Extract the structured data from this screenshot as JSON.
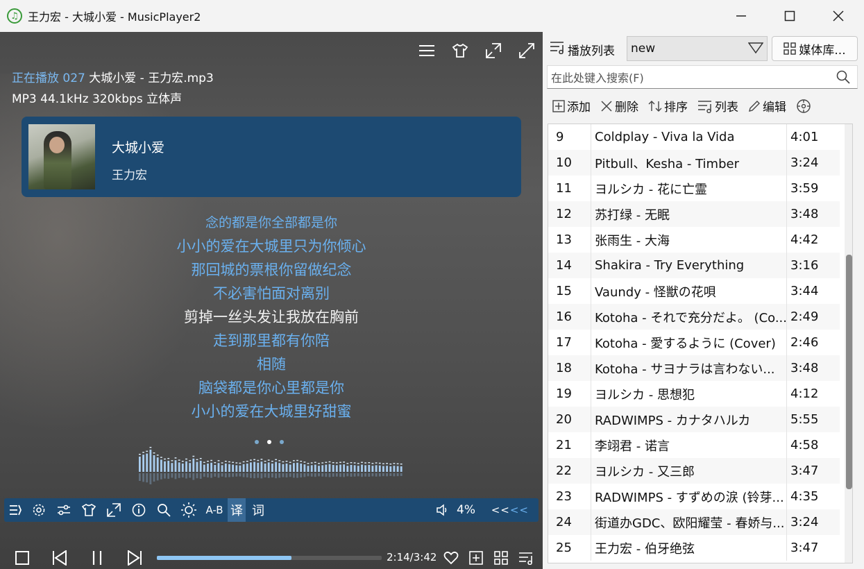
{
  "window": {
    "title": "王力宏 - 大城小爱 - MusicPlayer2",
    "minimize_icon": "minimize-icon",
    "maximize_icon": "maximize-icon",
    "close_icon": "close-icon"
  },
  "now_playing": {
    "prefix": "正在播放",
    "index": "027",
    "file": "大城小爱 - 王力宏.mp3",
    "format": "MP3 44.1kHz 320kbps 立体声",
    "song": "大城小爱",
    "artist": "王力宏"
  },
  "lyrics": [
    "念的都是你全部都是你",
    "小小的爱在大城里只为你倾心",
    "那回城的票根你留做纪念",
    "不必害怕面对离别",
    "剪掉一丝头发让我放在胸前",
    "走到那里都有你陪",
    "相随",
    "脑袋都是你心里都是你",
    "小小的爱在大城里好甜蜜"
  ],
  "current_lyric_index": 4,
  "controls": {
    "ab_label": "A-B",
    "translate_label": "译",
    "lyric_label": "词",
    "volume": "4%",
    "arrows_white": "<<",
    "arrows_blue": "<<"
  },
  "playback": {
    "time": "2:14/3:42",
    "progress": 0.6
  },
  "playlist": {
    "label": "播放列表",
    "selected": "new",
    "media_button": "媒体库...",
    "search_placeholder": "在此处键入搜索(F)",
    "toolbar": {
      "add": "添加",
      "delete": "删除",
      "sort": "排序",
      "list": "列表",
      "edit": "编辑"
    },
    "rows": [
      {
        "n": "9",
        "title": "Coldplay - Viva la Vida",
        "dur": "4:01"
      },
      {
        "n": "10",
        "title": "Pitbull、Kesha - Timber",
        "dur": "3:24"
      },
      {
        "n": "11",
        "title": "ヨルシカ - 花に亡霊",
        "dur": "3:59"
      },
      {
        "n": "12",
        "title": "苏打绿 - 无眠",
        "dur": "3:48"
      },
      {
        "n": "13",
        "title": "张雨生 - 大海",
        "dur": "4:42"
      },
      {
        "n": "14",
        "title": "Shakira - Try Everything",
        "dur": "3:16"
      },
      {
        "n": "15",
        "title": "Vaundy - 怪獣の花唄",
        "dur": "3:44"
      },
      {
        "n": "16",
        "title": "Kotoha - それで充分だよ。 (Co...",
        "dur": "2:49"
      },
      {
        "n": "17",
        "title": "Kotoha - 愛するように (Cover)",
        "dur": "2:46"
      },
      {
        "n": "18",
        "title": "Kotoha - サヨナラは言わない...",
        "dur": "3:48"
      },
      {
        "n": "19",
        "title": "ヨルシカ - 思想犯",
        "dur": "4:12"
      },
      {
        "n": "20",
        "title": "RADWIMPS - カナタハルカ",
        "dur": "5:55"
      },
      {
        "n": "21",
        "title": "李翊君 - 诺言",
        "dur": "4:58"
      },
      {
        "n": "22",
        "title": "ヨルシカ - 又三郎",
        "dur": "3:47"
      },
      {
        "n": "23",
        "title": "RADWIMPS - すずめの涙 (铃芽...",
        "dur": "4:35"
      },
      {
        "n": "24",
        "title": "街道办GDC、欧阳耀莹 - 春娇与...",
        "dur": "3:24"
      },
      {
        "n": "25",
        "title": "王力宏 - 伯牙绝弦",
        "dur": "3:47"
      }
    ]
  },
  "spectrum_levels": [
    0.55,
    0.62,
    0.66,
    0.8,
    0.6,
    0.52,
    0.44,
    0.38,
    0.4,
    0.32,
    0.42,
    0.34,
    0.3,
    0.38,
    0.32,
    0.48,
    0.36,
    0.4,
    0.26,
    0.3,
    0.33,
    0.25,
    0.32,
    0.24,
    0.3,
    0.28,
    0.26,
    0.24,
    0.23,
    0.28,
    0.3,
    0.34,
    0.36,
    0.33,
    0.37,
    0.3,
    0.34,
    0.3,
    0.36,
    0.32,
    0.28,
    0.3,
    0.26,
    0.32,
    0.33,
    0.3,
    0.27,
    0.22,
    0.24,
    0.26,
    0.22,
    0.24,
    0.26,
    0.28,
    0.25,
    0.24,
    0.26,
    0.27,
    0.22,
    0.25,
    0.24,
    0.22,
    0.26,
    0.24,
    0.25,
    0.22,
    0.24,
    0.23,
    0.21,
    0.22,
    0.2,
    0.22,
    0.21,
    0.2
  ]
}
